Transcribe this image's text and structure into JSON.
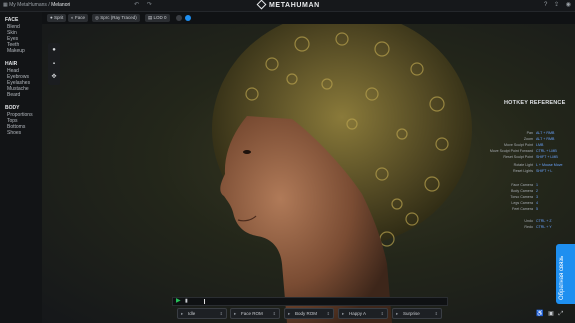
{
  "breadcrumb": {
    "root": "My MetaHumans",
    "separator": "/",
    "current": "Melanori"
  },
  "brand": {
    "name": "METAHUMAN"
  },
  "toolbar": {
    "pills": [
      "Sprit",
      "Face",
      "Sprc (Ray Traced)",
      "LOD 0"
    ]
  },
  "sidebar": {
    "face_header": "FACE",
    "face_items": [
      "Blend",
      "Skin",
      "Eyes",
      "Teeth",
      "Makeup"
    ],
    "hair_header": "HAIR",
    "hair_items": [
      "Head",
      "Eyebrows",
      "Eyelashes",
      "Mustache",
      "Beard"
    ],
    "body_header": "BODY",
    "body_items": [
      "Proportions",
      "Tops",
      "Bottoms",
      "Shoes"
    ]
  },
  "hotkeys": {
    "title": "HOTKEY REFERENCE",
    "rows": [
      {
        "action": "Pan",
        "key": "ALT + RMB"
      },
      {
        "action": "Zoom",
        "key": "ALT + RMB"
      },
      {
        "action": "Move Sculpt Point",
        "key": "LMB"
      },
      {
        "action": "Move Sculpt Point Forward",
        "key": "CTRL + LMB"
      },
      {
        "action": "Reset Sculpt Point",
        "key": "SHIFT + LMB"
      },
      {
        "action": "Rotate Light",
        "key": "L + Mouse Move"
      },
      {
        "action": "Reset Lights",
        "key": "SHIFT + L"
      },
      {
        "action": "Face Camera",
        "key": "1"
      },
      {
        "action": "Body Camera",
        "key": "2"
      },
      {
        "action": "Torso Camera",
        "key": "3"
      },
      {
        "action": "Legs Camera",
        "key": "4"
      },
      {
        "action": "Feet Camera",
        "key": "5"
      },
      {
        "action": "Undo",
        "key": "CTRL + Z"
      },
      {
        "action": "Redo",
        "key": "CTRL + Y"
      }
    ]
  },
  "feedback": {
    "label": "Обратная связь"
  },
  "bottom": {
    "dropdowns": [
      "Idle",
      "Face ROM",
      "Body ROM",
      "Happy A",
      "Surprise"
    ]
  },
  "colors": {
    "accent": "#1e8ff0",
    "play": "#26c25a",
    "hotkey_key": "#6aa4ff"
  }
}
